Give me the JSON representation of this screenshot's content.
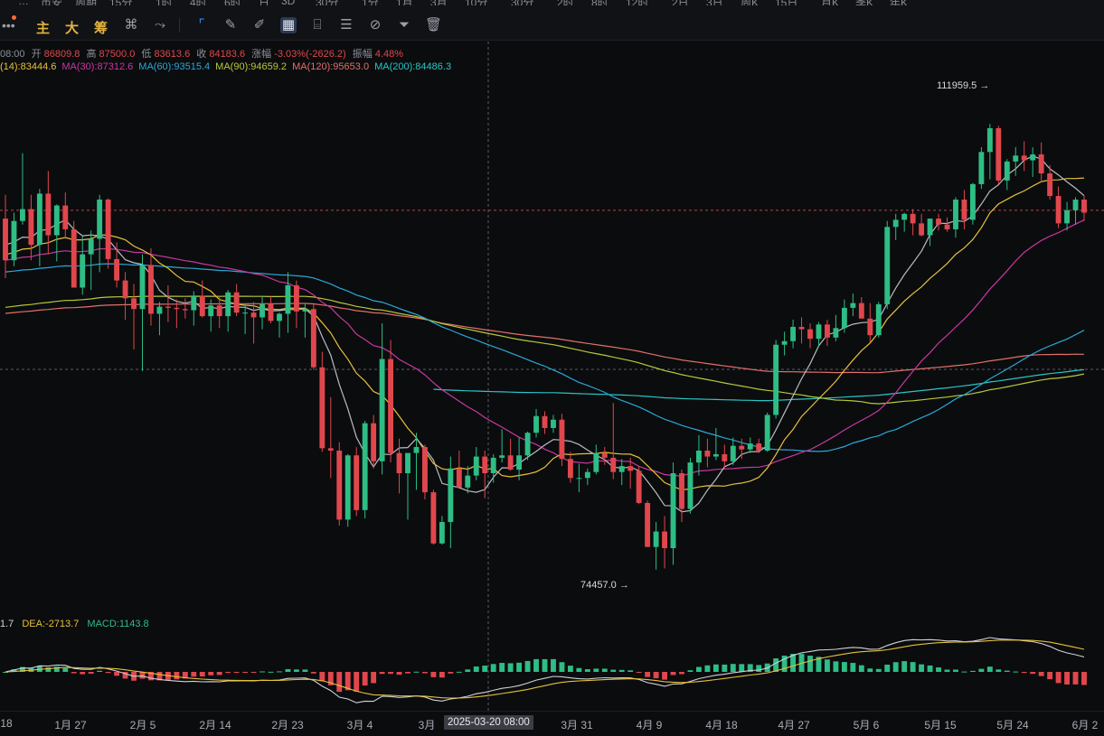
{
  "toolbar": {
    "top_partial": [
      "…",
      "币安",
      "周期",
      "15分",
      "1时",
      "4时",
      "6时",
      "日",
      "3D",
      "30分",
      "1分",
      "1月",
      "3月",
      "10分",
      "30分",
      "2时",
      "8时",
      "12时",
      "2日",
      "3日",
      "周K",
      "15日",
      "月K",
      "季K",
      "年K"
    ],
    "logo_dots": "•",
    "main_label": "主",
    "big_label": "大",
    "chip_label": "筹"
  },
  "info": {
    "time": "08:00",
    "open_label": "开",
    "open": "86809.8",
    "high_label": "高",
    "high": "87500.0",
    "low_label": "低",
    "low": "83613.6",
    "close_label": "收",
    "close": "84183.6",
    "change_label": "涨幅",
    "change": "-3.03%(-2626.2)",
    "amplitude_label": "振幅",
    "amplitude": "4.48%"
  },
  "ma": [
    {
      "text": "(14):83444.6",
      "color": "#e6c13a"
    },
    {
      "text": "MA(30):87312.6",
      "color": "#c7389f"
    },
    {
      "text": "MA(60):93515.4",
      "color": "#2aa8d8"
    },
    {
      "text": "MA(90):94659.2",
      "color": "#b8c83a"
    },
    {
      "text": "MA(120):95653.0",
      "color": "#e0706a"
    },
    {
      "text": "MA(200):84486.3",
      "color": "#29c5c7"
    }
  ],
  "macd": {
    "dif": "1.7",
    "dea": "DEA:-2713.7",
    "macd": "MACD:1143.8"
  },
  "annotations": {
    "high": "111959.5",
    "low": "74457.0"
  },
  "xaxis": {
    "labels": [
      "18",
      "1月 27",
      "2月 5",
      "2月 14",
      "2月 23",
      "3月 4",
      "3月",
      "3月 31",
      "4月 9",
      "4月 18",
      "4月 27",
      "5月 6",
      "5月 15",
      "5月 24",
      "6月 2"
    ],
    "crosshair_label": "2025-03-20 08:00"
  },
  "colors": {
    "up": "#2ebd85",
    "down": "#e0474c",
    "bg": "#0b0c0e"
  },
  "chart_data": {
    "type": "candlestick",
    "ohlc_note": "daily candles, approximate",
    "candles": [
      [
        104000,
        106000,
        99000,
        100500
      ],
      [
        100500,
        104500,
        100000,
        103800
      ],
      [
        103800,
        109500,
        103500,
        104800
      ],
      [
        104800,
        106000,
        100500,
        101800
      ],
      [
        101800,
        106500,
        100000,
        106100
      ],
      [
        106100,
        108000,
        101000,
        102600
      ],
      [
        102600,
        105200,
        100400,
        105100
      ],
      [
        105100,
        106200,
        102300,
        103100
      ],
      [
        103100,
        103800,
        98400,
        98200
      ],
      [
        98200,
        102500,
        97600,
        101000
      ],
      [
        101000,
        103000,
        98000,
        102300
      ],
      [
        102300,
        106000,
        99500,
        105600
      ],
      [
        105600,
        105700,
        99800,
        100600
      ],
      [
        100600,
        102000,
        98200,
        98800
      ],
      [
        98800,
        99500,
        95500,
        97300
      ],
      [
        97300,
        98500,
        93000,
        96400
      ],
      [
        96400,
        101000,
        91200,
        100100
      ],
      [
        100100,
        101500,
        95000,
        96000
      ],
      [
        96000,
        97000,
        94200,
        96600
      ],
      [
        96600,
        98400,
        95300,
        96500
      ],
      [
        96500,
        97200,
        94800,
        96400
      ],
      [
        96400,
        97300,
        95600,
        96300
      ],
      [
        96300,
        97900,
        95000,
        97500
      ],
      [
        97500,
        98800,
        95700,
        95800
      ],
      [
        95800,
        97200,
        94500,
        96700
      ],
      [
        96700,
        97500,
        94800,
        95800
      ],
      [
        95800,
        98000,
        94500,
        97800
      ],
      [
        97800,
        98500,
        95800,
        96100
      ],
      [
        96100,
        96800,
        94300,
        96100
      ],
      [
        96100,
        97000,
        93500,
        95700
      ],
      [
        95700,
        97500,
        94700,
        96800
      ],
      [
        96800,
        97500,
        95200,
        95400
      ],
      [
        95400,
        96100,
        94000,
        96000
      ],
      [
        96000,
        99500,
        94400,
        98400
      ],
      [
        98400,
        98800,
        94800,
        96200
      ],
      [
        96200,
        96900,
        94000,
        96400
      ],
      [
        96400,
        96800,
        91300,
        91500
      ],
      [
        91500,
        92800,
        84400,
        84700
      ],
      [
        84700,
        89000,
        82200,
        84500
      ],
      [
        84500,
        85200,
        78200,
        78700
      ],
      [
        78700,
        84200,
        78100,
        84100
      ],
      [
        84100,
        84800,
        79000,
        79500
      ],
      [
        79500,
        87000,
        78800,
        86800
      ],
      [
        86800,
        87500,
        83000,
        83600
      ],
      [
        83600,
        95200,
        82500,
        92200
      ],
      [
        92200,
        93800,
        83500,
        84300
      ],
      [
        84300,
        85500,
        80900,
        82600
      ],
      [
        82600,
        84300,
        78700,
        84300
      ],
      [
        84300,
        86000,
        81200,
        84800
      ],
      [
        84800,
        85000,
        80400,
        81000
      ],
      [
        81000,
        81200,
        76600,
        76700
      ],
      [
        76700,
        79000,
        76600,
        78500
      ],
      [
        78500,
        84000,
        76300,
        83000
      ],
      [
        83000,
        84500,
        81500,
        81400
      ],
      [
        81400,
        83200,
        80900,
        82400
      ],
      [
        82400,
        84800,
        82000,
        84000
      ],
      [
        84000,
        84500,
        80500,
        82600
      ],
      [
        82600,
        84200,
        81800,
        83900
      ],
      [
        83900,
        86300,
        83500,
        84100
      ],
      [
        84100,
        85500,
        82800,
        82900
      ],
      [
        82900,
        85600,
        82000,
        84100
      ],
      [
        84100,
        86100,
        83700,
        86000
      ],
      [
        86000,
        88000,
        85600,
        87400
      ],
      [
        87400,
        87800,
        85900,
        86400
      ],
      [
        86400,
        87500,
        86000,
        87100
      ],
      [
        87100,
        87600,
        83200,
        83800
      ],
      [
        83800,
        84400,
        81800,
        82200
      ],
      [
        82200,
        83400,
        81000,
        82200
      ],
      [
        82200,
        83000,
        81600,
        82700
      ],
      [
        82700,
        85000,
        82500,
        84300
      ],
      [
        84300,
        84800,
        83300,
        83900
      ],
      [
        83900,
        88500,
        82100,
        82700
      ],
      [
        82700,
        83800,
        81600,
        83200
      ],
      [
        83200,
        83900,
        81300,
        82800
      ],
      [
        82800,
        83200,
        80000,
        80100
      ],
      [
        80100,
        80300,
        76600,
        76400
      ],
      [
        76400,
        78500,
        74500,
        77700
      ],
      [
        77700,
        79000,
        74600,
        76300
      ],
      [
        76300,
        83500,
        74900,
        82600
      ],
      [
        82600,
        82900,
        78500,
        79600
      ],
      [
        79600,
        83900,
        79200,
        83500
      ],
      [
        83500,
        85800,
        82400,
        84500
      ],
      [
        84500,
        85500,
        83100,
        84000
      ],
      [
        84000,
        86400,
        83700,
        84200
      ],
      [
        84200,
        85000,
        83000,
        83600
      ],
      [
        83600,
        85600,
        83300,
        84900
      ],
      [
        84900,
        85500,
        83800,
        84600
      ],
      [
        84600,
        85600,
        84300,
        85100
      ],
      [
        85100,
        85500,
        84300,
        84500
      ],
      [
        84500,
        87700,
        84400,
        87500
      ],
      [
        87500,
        93800,
        87200,
        93400
      ],
      [
        93400,
        94500,
        92500,
        93700
      ],
      [
        93700,
        95500,
        93100,
        94900
      ],
      [
        94900,
        95700,
        93500,
        94700
      ],
      [
        94700,
        95200,
        93100,
        93900
      ],
      [
        93900,
        95300,
        93200,
        95100
      ],
      [
        95100,
        95500,
        93300,
        94000
      ],
      [
        94000,
        95900,
        93700,
        94800
      ],
      [
        94800,
        97200,
        94400,
        96500
      ],
      [
        96500,
        97700,
        95800,
        96900
      ],
      [
        96900,
        97400,
        95700,
        95600
      ],
      [
        95600,
        96900,
        93600,
        94200
      ],
      [
        94200,
        97000,
        94000,
        96800
      ],
      [
        96800,
        103800,
        96400,
        103300
      ],
      [
        103300,
        104400,
        102200,
        103900
      ],
      [
        103900,
        104500,
        102900,
        104400
      ],
      [
        104400,
        104800,
        102600,
        103600
      ],
      [
        103600,
        104400,
        102500,
        102600
      ],
      [
        102600,
        104000,
        101700,
        104000
      ],
      [
        104000,
        104400,
        103000,
        103500
      ],
      [
        103500,
        104100,
        102900,
        103100
      ],
      [
        103100,
        105800,
        102400,
        105600
      ],
      [
        105600,
        106400,
        103100,
        103900
      ],
      [
        103900,
        107000,
        103500,
        106900
      ],
      [
        106900,
        110000,
        106500,
        109600
      ],
      [
        109600,
        111959.5,
        107300,
        111600
      ],
      [
        111600,
        111800,
        106900,
        107200
      ],
      [
        107200,
        109000,
        106400,
        108800
      ],
      [
        108800,
        110000,
        107600,
        109300
      ],
      [
        109300,
        110500,
        108000,
        108900
      ],
      [
        108900,
        110000,
        107500,
        109400
      ],
      [
        109400,
        110400,
        107200,
        107800
      ],
      [
        107800,
        108500,
        105600,
        105900
      ],
      [
        105900,
        106700,
        103200,
        103600
      ],
      [
        103600,
        105400,
        103000,
        104700
      ],
      [
        104700,
        105800,
        103500,
        105600
      ],
      [
        105600,
        105900,
        103800,
        104500
      ]
    ],
    "moving_averages": [
      "MA14",
      "MA30",
      "MA60",
      "MA90",
      "MA120",
      "MA200"
    ],
    "price_range": [
      70000,
      116000
    ],
    "macd_panel": true
  }
}
